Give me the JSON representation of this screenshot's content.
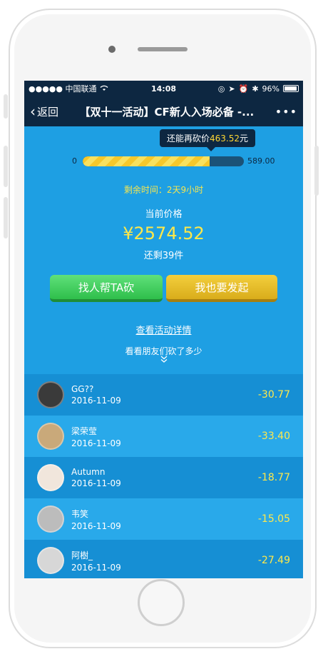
{
  "status_bar": {
    "carrier": "●●●●● 中国联通",
    "time": "14:08",
    "battery": "96%"
  },
  "nav": {
    "back_label": "返回",
    "title": "【双十一活动】CF新人入场必备 -...",
    "more_label": "•••"
  },
  "tooltip": {
    "prefix": "还能再砍价",
    "amount": "463.52",
    "suffix": "元"
  },
  "progress": {
    "min_label": "0",
    "max_label": "589.00",
    "fill_fraction": 0.787
  },
  "remaining_time": "剩余时间：2天9小时",
  "price": {
    "label": "当前价格",
    "value": "¥2574.52",
    "stock": "还剩39件"
  },
  "buttons": {
    "help_cut": "找人帮TA砍",
    "start_own": "我也要发起"
  },
  "details_link": "查看活动详情",
  "friends_hint": "看看朋友们砍了多少",
  "friends": [
    {
      "name": "GG??",
      "date": "2016-11-09",
      "amount": "-30.77",
      "avatar_color": "#3a3a3a"
    },
    {
      "name": "梁荣莹",
      "date": "2016-11-09",
      "amount": "-33.40",
      "avatar_color": "#c9a97a"
    },
    {
      "name": "Autumn",
      "date": "2016-11-09",
      "amount": "-18.77",
      "avatar_color": "#f1e6dc"
    },
    {
      "name": "韦笑",
      "date": "2016-11-09",
      "amount": "-15.05",
      "avatar_color": "#bcbcbc"
    },
    {
      "name": "阿樹_",
      "date": "2016-11-09",
      "amount": "-27.49",
      "avatar_color": "#d7d7d7"
    }
  ],
  "colors": {
    "screen_bg": "#1e9fe3",
    "nav_bg": "#0d2741",
    "accent_yellow": "#ffe84a",
    "button_green": "#2fbf4b",
    "button_yellow": "#d9ad1b"
  }
}
